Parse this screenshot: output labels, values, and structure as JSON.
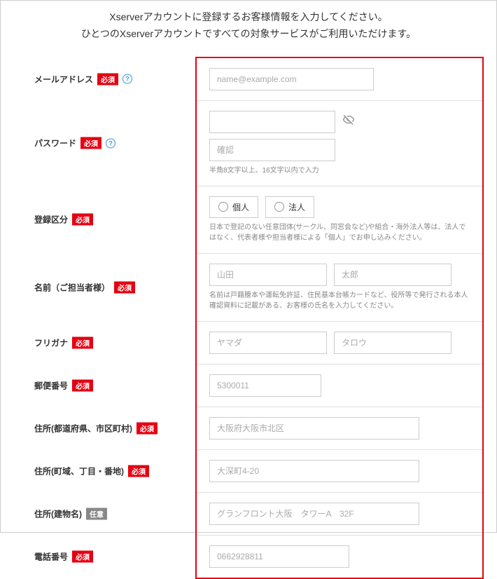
{
  "intro": {
    "line1": "Xserverアカウントに登録するお客様情報を入力してください。",
    "line2": "ひとつのXserverアカウントですべての対象サービスがご利用いただけます。"
  },
  "badges": {
    "required": "必須",
    "optional": "任意"
  },
  "fields": {
    "email": {
      "label": "メールアドレス",
      "placeholder": "name@example.com"
    },
    "password": {
      "label": "パスワード",
      "confirm_placeholder": "確認",
      "hint": "半角8文字以上、16文字以内で入力"
    },
    "reg_type": {
      "label": "登録区分",
      "option_individual": "個人",
      "option_corporate": "法人",
      "hint": "日本で登記のない任意団体(サークル、同窓会など)や組合・海外法人等は、法人ではなく、代表者様や担当者様による「個人」でお申し込みください。"
    },
    "name": {
      "label": "名前（ご担当者様）",
      "placeholder_last": "山田",
      "placeholder_first": "太郎",
      "hint": "名前は戸籍謄本や運転免許証、住民基本台帳カードなど、役所等で発行される本人確認資料に記載がある、お客様の氏名を入力してください。"
    },
    "furigana": {
      "label": "フリガナ",
      "placeholder_last": "ヤマダ",
      "placeholder_first": "タロウ"
    },
    "postcode": {
      "label": "郵便番号",
      "placeholder": "5300011"
    },
    "address1": {
      "label": "住所(都道府県、市区町村)",
      "placeholder": "大阪府大阪市北区"
    },
    "address2": {
      "label": "住所(町域、丁目・番地)",
      "placeholder": "大深町4-20"
    },
    "address3": {
      "label": "住所(建物名)",
      "placeholder": "グランフロント大阪　タワーA　32F"
    },
    "phone": {
      "label": "電話番号",
      "placeholder": "0662928811"
    }
  }
}
